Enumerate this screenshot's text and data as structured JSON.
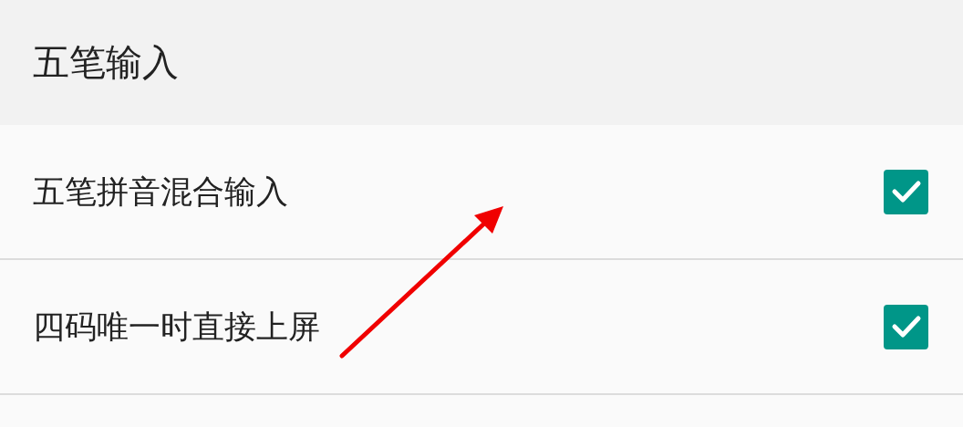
{
  "header": {
    "title": "五笔输入"
  },
  "settings": [
    {
      "label": "五笔拼音混合输入",
      "checked": true
    },
    {
      "label": "四码唯一时直接上屏",
      "checked": true
    }
  ]
}
